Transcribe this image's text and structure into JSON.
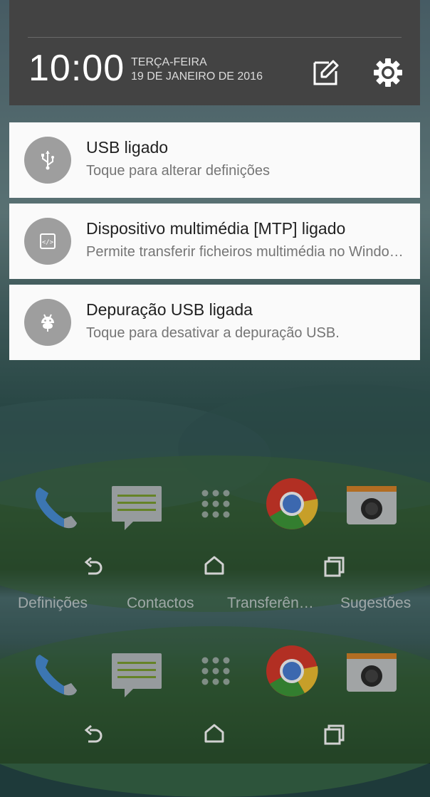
{
  "header": {
    "time": "10:00",
    "day": "TERÇA-FEIRA",
    "date": "19 DE JANEIRO DE 2016",
    "edit_icon": "edit-pencil-icon",
    "settings_icon": "gear-icon"
  },
  "notifications": [
    {
      "title": "USB ligado",
      "text": "Toque para alterar definições",
      "icon": "usb-icon"
    },
    {
      "title": "Dispositivo multimédia [MTP] ligado",
      "text": "Permite transferir ficheiros multimédia no Windows ou através da aplicação Android File Transfer no Mac.",
      "icon": "mtp-icon"
    },
    {
      "title": "Depuração USB ligada",
      "text": "Toque para desativar a depuração USB.",
      "icon": "android-debug-icon"
    }
  ],
  "app_labels": [
    "Definições",
    "Contactos",
    "Transferên…",
    "Sugestões"
  ],
  "dock": [
    "phone-icon",
    "messages-icon",
    "app-drawer-icon",
    "chrome-icon",
    "camera-icon"
  ],
  "nav": [
    "back-icon",
    "home-icon",
    "recents-icon"
  ],
  "colors": {
    "header_bg": "#434343",
    "card_bg": "#fafafa",
    "icon_circle": "#9e9e9e"
  }
}
